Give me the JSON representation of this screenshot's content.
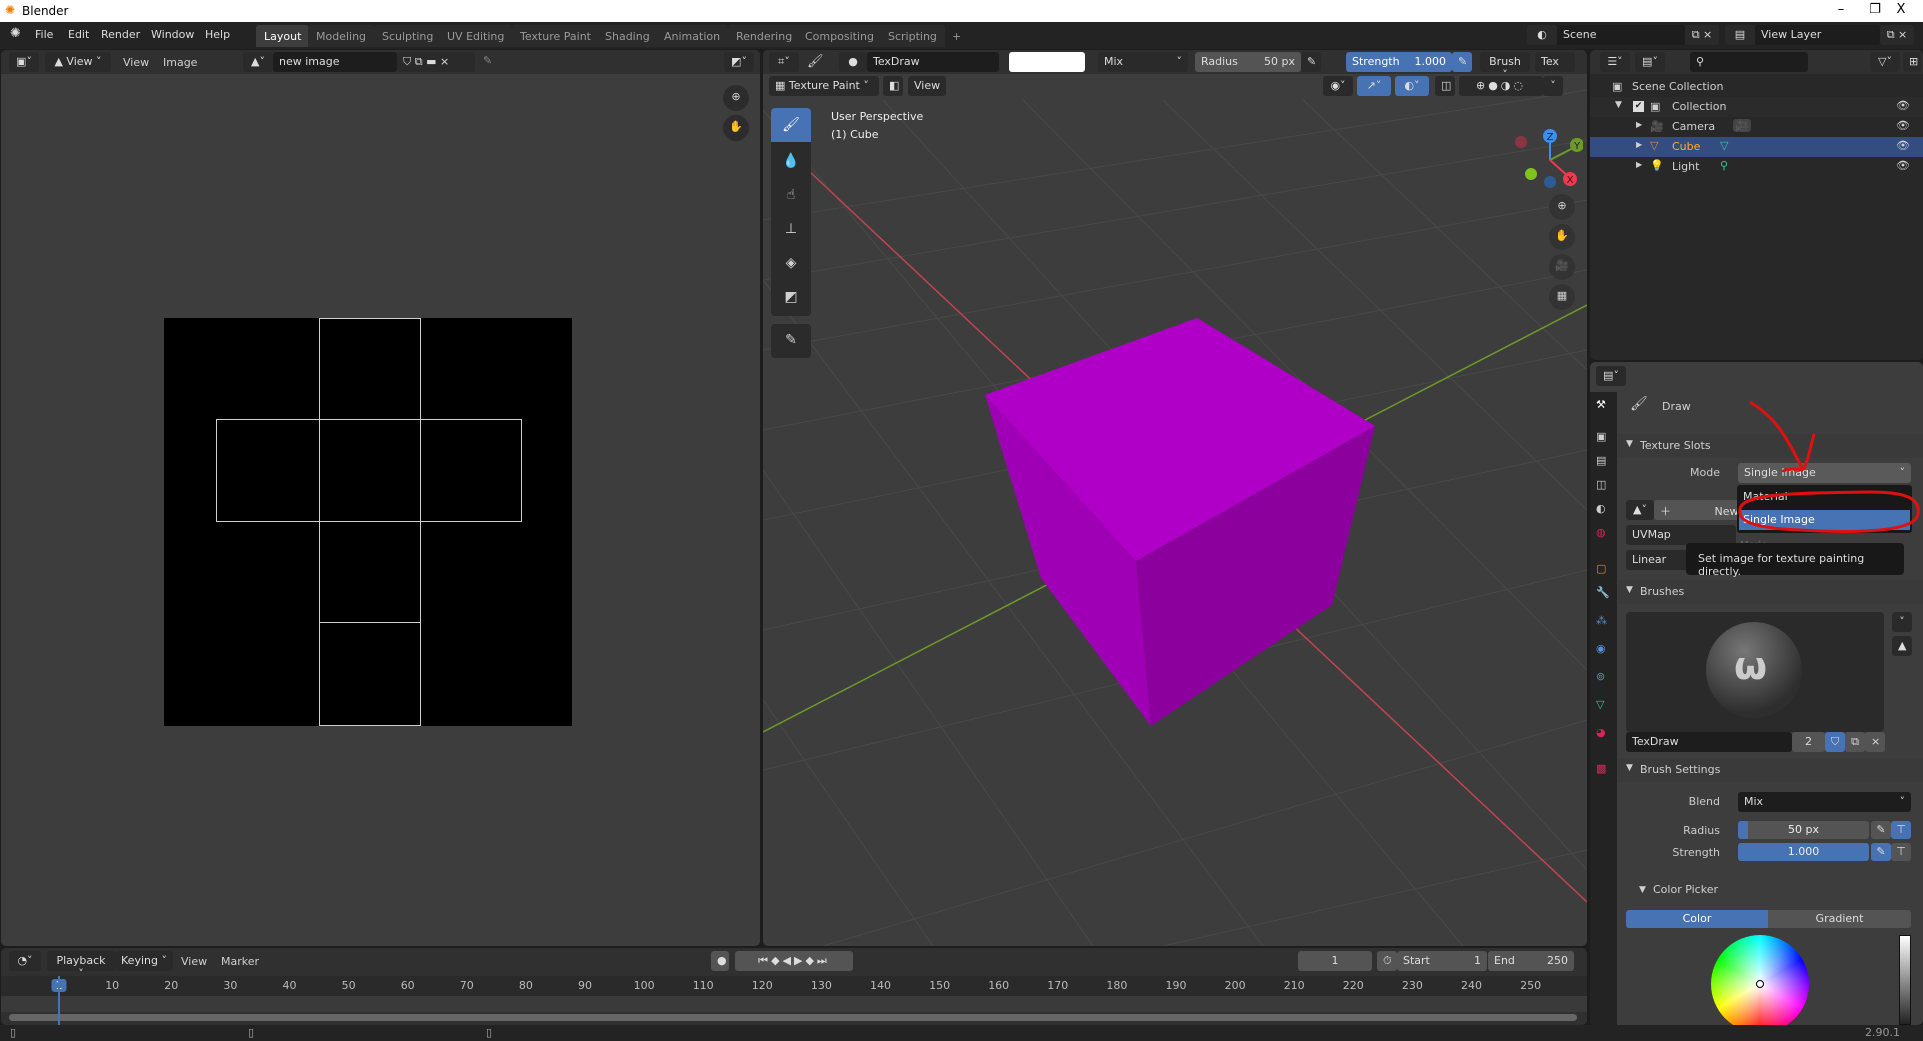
{
  "window": {
    "title": "Blender",
    "minimize": "–",
    "restore": "❐",
    "close": "X"
  },
  "menu": [
    "File",
    "Edit",
    "Render",
    "Window",
    "Help"
  ],
  "workspaces": [
    "Layout",
    "Modeling",
    "Sculpting",
    "UV Editing",
    "Texture Paint",
    "Shading",
    "Animation",
    "Rendering",
    "Compositing",
    "Scripting",
    "+"
  ],
  "active_workspace": "Layout",
  "scene": {
    "scene_name": "Scene",
    "view_layer": "View Layer"
  },
  "image_editor": {
    "view_mode": "View",
    "menu": [
      "View",
      "Image"
    ],
    "image_name": "new image"
  },
  "viewport": {
    "brush_name": "TexDraw",
    "blend": "Mix",
    "radius_label": "Radius",
    "radius_value": "50 px",
    "strength_label": "Strength",
    "strength_value": "1.000",
    "brush_menu": "Brush",
    "tex_menu": "Tex",
    "mode": "Texture Paint",
    "view_menu": "View",
    "overlay_line1": "User Perspective",
    "overlay_line2": "(1) Cube",
    "tools": [
      "draw",
      "soften",
      "smear",
      "clone",
      "fill",
      "mask",
      "annotate"
    ],
    "gizmo": {
      "x": "X",
      "y": "Y",
      "z": "Z"
    },
    "colors": {
      "cube": "#b000c8",
      "x_axis": "#c0444f",
      "y_axis": "#6e9a2a",
      "grid": "#474747",
      "background": "#3d3d3d"
    }
  },
  "outliner": {
    "root": "Scene Collection",
    "items": [
      {
        "label": "Collection",
        "icon": "collection-icon"
      },
      {
        "label": "Camera",
        "icon": "camera-icon"
      },
      {
        "label": "Cube",
        "icon": "mesh-icon",
        "selected": true
      },
      {
        "label": "Light",
        "icon": "light-icon"
      }
    ]
  },
  "properties": {
    "tool_name": "Draw",
    "texture_slots": {
      "title": "Texture Slots",
      "mode_label": "Mode",
      "mode_value": "Single Image",
      "new_label": "New",
      "uvmap": "UVMap",
      "interp": "Linear"
    },
    "mode_dropdown": {
      "options": [
        "Material",
        "Single Image"
      ],
      "selected": "Single Image",
      "hidden_label": "Mode"
    },
    "tooltip": "Set image for texture painting directly.",
    "brushes": {
      "title": "Brushes",
      "brush_name": "TexDraw",
      "users": "2"
    },
    "brush_settings": {
      "title": "Brush Settings",
      "blend_label": "Blend",
      "blend_value": "Mix",
      "radius_label": "Radius",
      "radius_value": "50 px",
      "strength_label": "Strength",
      "strength_value": "1.000",
      "radius_fill": 0.08,
      "strength_fill": 1.0
    },
    "color_picker": {
      "title": "Color Picker",
      "tabs": [
        "Color",
        "Gradient"
      ],
      "active_tab": "Color"
    }
  },
  "timeline": {
    "menus": [
      "Playback",
      "Keying",
      "View",
      "Marker"
    ],
    "current_frame": "1",
    "start_label": "Start",
    "start": "1",
    "end_label": "End",
    "end": "250",
    "ticks": [
      "1",
      "10",
      "20",
      "30",
      "40",
      "50",
      "60",
      "70",
      "80",
      "90",
      "100",
      "110",
      "120",
      "130",
      "140",
      "150",
      "160",
      "170",
      "180",
      "190",
      "200",
      "210",
      "220",
      "230",
      "240",
      "250"
    ]
  },
  "status": {
    "version": "2.90.1"
  },
  "accent": "#4772b3"
}
